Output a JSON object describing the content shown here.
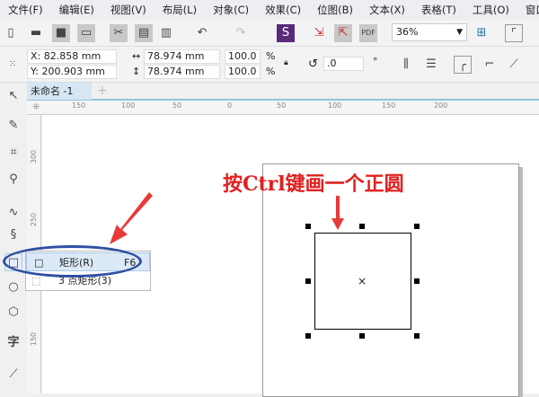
{
  "menu": [
    "文件(F)",
    "编辑(E)",
    "视图(V)",
    "布局(L)",
    "对象(C)",
    "效果(C)",
    "位图(B)",
    "文本(X)",
    "表格(T)",
    "工具(O)",
    "窗口"
  ],
  "toolbar": {
    "zoom": "36%"
  },
  "props": {
    "x": "X: 82.858 mm",
    "y": "Y: 200.903 mm",
    "w": "78.974 mm",
    "h": "78.974 mm",
    "sx": "100.0",
    "sy": "100.0",
    "pct": "%",
    "rot": ".0",
    "deg": "°"
  },
  "doc_tab": "未命名 -1",
  "ruler_h": [
    "150",
    "100",
    "50",
    "0",
    "50",
    "100",
    "150",
    "200"
  ],
  "ruler_v": [
    "300",
    "250",
    "150"
  ],
  "flyout": {
    "items": [
      {
        "label": "矩形(R)",
        "shortcut": "F6"
      },
      {
        "label": "3 点矩形(3)",
        "shortcut": ""
      }
    ]
  },
  "annotation": "按Ctrl键画一个正圆",
  "colors": {
    "annotation": "#e02020",
    "highlight": "#2e4fa3"
  }
}
